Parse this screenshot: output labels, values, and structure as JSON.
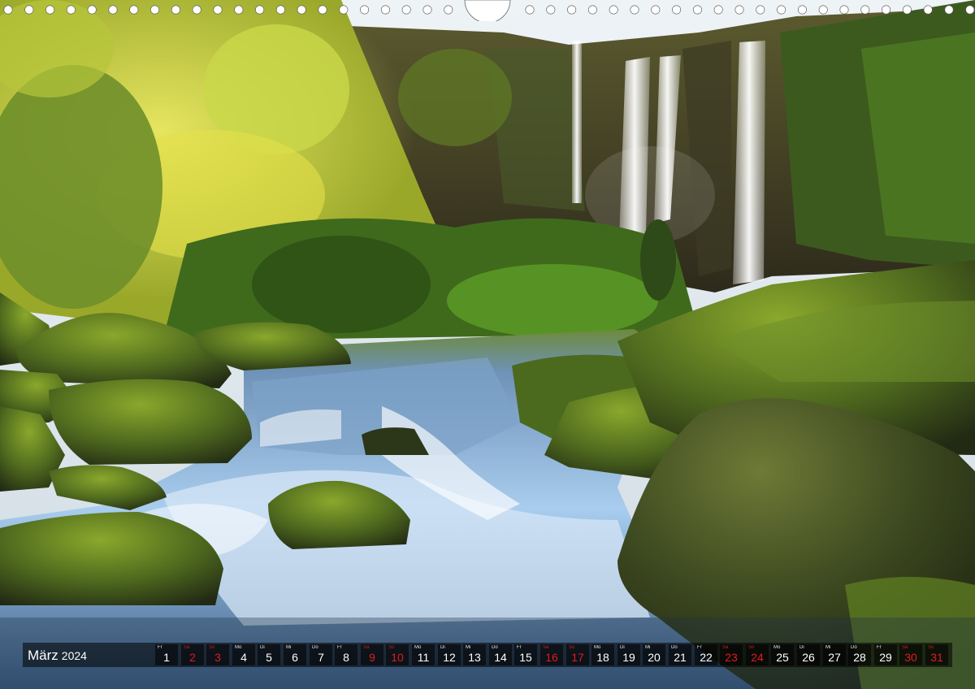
{
  "photo": {
    "subject": "waterfall-river-forest",
    "colors": {
      "sky": "#dfe8ee",
      "foliage": "#c9d62a",
      "fern": "#3f6a1c",
      "moss": "#5d7a22",
      "rock": "#2d3424",
      "water": "#9ec4e4",
      "water_dark": "#2f4f74"
    }
  },
  "calendar": {
    "month": "März",
    "year": "2024",
    "weekend_color": "#e21b1b",
    "text_color": "#ffffff",
    "days": [
      {
        "dow": "Fr",
        "num": "1",
        "weekend": false
      },
      {
        "dow": "Sa",
        "num": "2",
        "weekend": true
      },
      {
        "dow": "So",
        "num": "3",
        "weekend": true
      },
      {
        "dow": "Mo",
        "num": "4",
        "weekend": false
      },
      {
        "dow": "Di",
        "num": "5",
        "weekend": false
      },
      {
        "dow": "Mi",
        "num": "6",
        "weekend": false
      },
      {
        "dow": "Do",
        "num": "7",
        "weekend": false
      },
      {
        "dow": "Fr",
        "num": "8",
        "weekend": false
      },
      {
        "dow": "Sa",
        "num": "9",
        "weekend": true
      },
      {
        "dow": "So",
        "num": "10",
        "weekend": true
      },
      {
        "dow": "Mo",
        "num": "11",
        "weekend": false
      },
      {
        "dow": "Di",
        "num": "12",
        "weekend": false
      },
      {
        "dow": "Mi",
        "num": "13",
        "weekend": false
      },
      {
        "dow": "Do",
        "num": "14",
        "weekend": false
      },
      {
        "dow": "Fr",
        "num": "15",
        "weekend": false
      },
      {
        "dow": "Sa",
        "num": "16",
        "weekend": true
      },
      {
        "dow": "So",
        "num": "17",
        "weekend": true
      },
      {
        "dow": "Mo",
        "num": "18",
        "weekend": false
      },
      {
        "dow": "Di",
        "num": "19",
        "weekend": false
      },
      {
        "dow": "Mi",
        "num": "20",
        "weekend": false
      },
      {
        "dow": "Do",
        "num": "21",
        "weekend": false
      },
      {
        "dow": "Fr",
        "num": "22",
        "weekend": false
      },
      {
        "dow": "Sa",
        "num": "23",
        "weekend": true
      },
      {
        "dow": "So",
        "num": "24",
        "weekend": true
      },
      {
        "dow": "Mo",
        "num": "25",
        "weekend": false
      },
      {
        "dow": "Di",
        "num": "26",
        "weekend": false
      },
      {
        "dow": "Mi",
        "num": "27",
        "weekend": false
      },
      {
        "dow": "Do",
        "num": "28",
        "weekend": false
      },
      {
        "dow": "Fr",
        "num": "29",
        "weekend": false
      },
      {
        "dow": "Sa",
        "num": "30",
        "weekend": true
      },
      {
        "dow": "So",
        "num": "31",
        "weekend": true
      }
    ]
  },
  "binding": {
    "hole_color": "#ffffff",
    "hanger_color": "#ffffff"
  }
}
